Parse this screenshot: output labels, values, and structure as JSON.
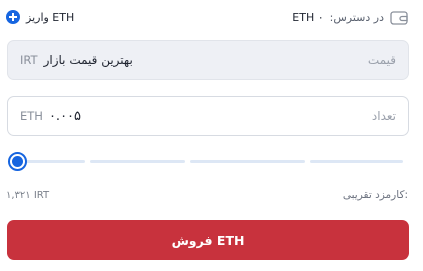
{
  "header": {
    "deposit_label": "واریز ETH",
    "available_label": "در دسترس:",
    "available_value": "ETH ۰"
  },
  "price_field": {
    "label": "قیمت",
    "value": "بهترین قیمت بازار",
    "unit": "IRT"
  },
  "amount_field": {
    "label": "تعداد",
    "value": "۰.۰۰۵",
    "unit": "ETH"
  },
  "slider": {
    "percent": 0,
    "segments": 5
  },
  "fee": {
    "label": "کارمزد تقریبی:",
    "value": "۱,۳۲۱ IRT"
  },
  "sell_button": {
    "label": "فروش ETH"
  },
  "colors": {
    "accent": "#1665e0",
    "sell": "#c8323d"
  },
  "icons": {
    "deposit": "plus-circle-icon",
    "wallet": "wallet-icon"
  }
}
